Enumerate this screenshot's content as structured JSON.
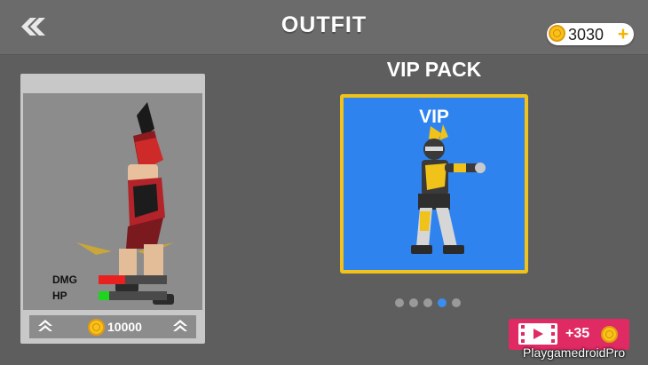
{
  "header": {
    "title": "OUTFIT",
    "coins": "3030",
    "add_coins_label": "+"
  },
  "character_card": {
    "stats": [
      {
        "label": "DMG",
        "value_fraction": 0.39,
        "color": "#e82020"
      },
      {
        "label": "HP",
        "value_fraction": 0.16,
        "color": "#1fd41f"
      }
    ],
    "price": "10000"
  },
  "pack": {
    "title": "VIP PACK",
    "card_label": "VIP"
  },
  "pager": {
    "count": 5,
    "active_index": 3
  },
  "video_reward": {
    "reward": "+35"
  },
  "watermark": "PlaygamedroidPro",
  "colors": {
    "background": "#5e5e5e",
    "topbar": "#6b6b6b",
    "vip_card_bg": "#2f83ee",
    "vip_card_border": "#f0c21a",
    "reward_button": "#e02a64",
    "coin": "#f7c21b"
  },
  "icons": [
    "back-chevrons-icon",
    "coin-icon",
    "plus-icon",
    "upgrade-chevrons-icon",
    "video-icon"
  ]
}
